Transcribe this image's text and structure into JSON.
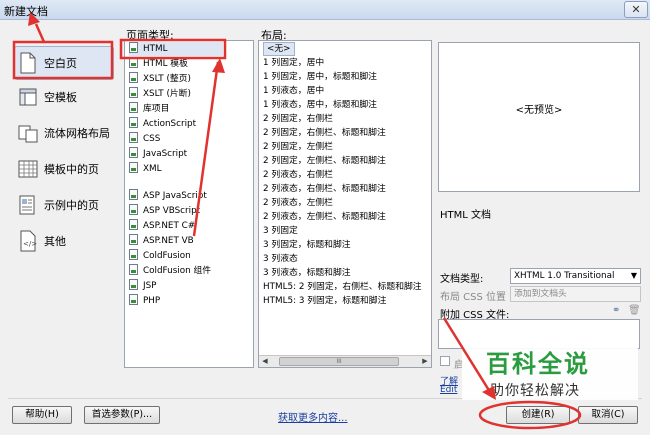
{
  "window": {
    "title": "新建文档",
    "close_label": "✕"
  },
  "categories": [
    {
      "label": "空白页",
      "icon": "blank-page-icon",
      "selected": true
    },
    {
      "label": "空模板",
      "icon": "blank-template-icon",
      "selected": false
    },
    {
      "label": "流体网格布局",
      "icon": "fluid-grid-icon",
      "selected": false
    },
    {
      "label": "模板中的页",
      "icon": "template-page-icon",
      "selected": false
    },
    {
      "label": "示例中的页",
      "icon": "sample-page-icon",
      "selected": false
    },
    {
      "label": "其他",
      "icon": "other-icon",
      "selected": false
    }
  ],
  "page_type": {
    "header": "页面类型:",
    "items": [
      {
        "label": "HTML",
        "selected": true
      },
      {
        "label": "HTML 模板",
        "selected": false
      },
      {
        "label": "XSLT (整页)",
        "selected": false
      },
      {
        "label": "XSLT (片断)",
        "selected": false
      },
      {
        "label": "库项目",
        "selected": false
      },
      {
        "label": "ActionScript",
        "selected": false
      },
      {
        "label": "CSS",
        "selected": false
      },
      {
        "label": "JavaScript",
        "selected": false
      },
      {
        "label": "XML",
        "selected": false
      },
      {
        "label": "ASP JavaScript",
        "selected": false
      },
      {
        "label": "ASP VBScript",
        "selected": false
      },
      {
        "label": "ASP.NET C#",
        "selected": false
      },
      {
        "label": "ASP.NET VB",
        "selected": false
      },
      {
        "label": "ColdFusion",
        "selected": false
      },
      {
        "label": "ColdFusion 组件",
        "selected": false
      },
      {
        "label": "JSP",
        "selected": false
      },
      {
        "label": "PHP",
        "selected": false
      }
    ]
  },
  "layout": {
    "header": "布局:",
    "items": [
      "<无>",
      "1 列固定，居中",
      "1 列固定，居中，标题和脚注",
      "1 列液态，居中",
      "1 列液态，居中，标题和脚注",
      "2 列固定，右侧栏",
      "2 列固定，右侧栏、标题和脚注",
      "2 列固定，左侧栏",
      "2 列固定，左侧栏、标题和脚注",
      "2 列液态，右侧栏",
      "2 列液态，右侧栏、标题和脚注",
      "2 列液态，左侧栏",
      "2 列液态，左侧栏、标题和脚注",
      "3 列固定",
      "3 列固定，标题和脚注",
      "3 列液态",
      "3 列液态，标题和脚注",
      "HTML5: 2 列固定，右侧栏、标题和脚注",
      "HTML5: 3 列固定，标题和脚注"
    ],
    "scroll_thumb": "III"
  },
  "preview": {
    "text": "<无预览>",
    "description": "HTML 文档"
  },
  "form": {
    "doctype_label": "文档类型:",
    "doctype_value": "XHTML 1.0 Transitional",
    "css_location_label": "布局 CSS 位置",
    "css_location_value": "添加到文档头",
    "attach_css_label": "附加 CSS 文件:",
    "enable_label": "启",
    "link_text": "了解",
    "link_text2": "Edit"
  },
  "buttons": {
    "help": "帮助(H)",
    "preferences": "首选参数(P)...",
    "get_more": "获取更多内容...",
    "create": "创建(R)",
    "cancel": "取消(C)"
  },
  "watermark": {
    "title": "百科全说",
    "subtitle": "助你轻松解决"
  },
  "colors": {
    "accent_selection": "#dde6f2",
    "annotation_red": "#e0322e",
    "watermark_green": "#2a9b3e",
    "link_blue": "#1a3fa0"
  }
}
